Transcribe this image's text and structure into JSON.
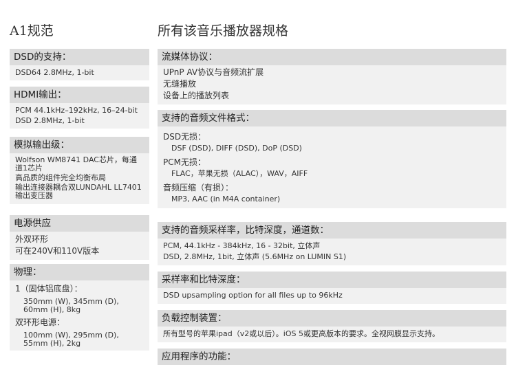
{
  "left_title": "A1规范",
  "right_title": "所有该音乐播放器规格",
  "left_sections": [
    {
      "header": "DSD的支持：",
      "lines": [
        "DSD64 2.8MHz, 1-bit"
      ]
    },
    {
      "header": "HDMI输出：",
      "lines": [
        "PCM 44.1kHz–192kHz, 16–24-bit",
        "DSD 2.8MHz, 1-bit"
      ]
    },
    {
      "header": "模拟输出级：",
      "lines": [
        "Wolfson WM8741 DAC芯片，每通道1芯片",
        "高品质的组件完全均衡布局",
        "输出连接器耦合双LUNDAHL LL7401输出变压器"
      ]
    },
    {
      "header": "电源供应",
      "lines": [
        "外双环形",
        "可在240V和110V版本"
      ]
    },
    {
      "header": "物理：",
      "sub1": "1（固体铝底盘）：",
      "sub1_detail": "350mm (W), 345mm (D), 60mm (H), 8kg",
      "sub2": "双环形电源：",
      "sub2_detail": "100mm (W), 295mm (D), 55mm (H), 2kg"
    }
  ],
  "right_sections": [
    {
      "header": "流媒体协议：",
      "lines": [
        "UPnP AV协议与音频流扩展",
        "无缝播放",
        "设备上的播放列表"
      ]
    },
    {
      "header": "支持的音频文件格式：",
      "groups": [
        {
          "label": "DSD无损：",
          "detail": "DSF (DSD), DIFF (DSD), DoP (DSD)"
        },
        {
          "label": "PCM无损：",
          "detail": "FLAC，苹果无损（ALAC），WAV，AIFF"
        },
        {
          "label": "音频压缩（有损）：",
          "detail": "MP3, AAC (in M4A container)"
        }
      ]
    },
    {
      "header": "支持的音频采样率，比特深度，通道数：",
      "lines": [
        "PCM, 44.1kHz - 384kHz, 16 - 32bit, 立体声",
        "DSD, 2.8MHz, 1bit, 立体声 (5.6MHz on LUMIN S1)"
      ]
    },
    {
      "header": "采样率和比特深度：",
      "lines": [
        "DSD upsampling option for all files up to 96kHz"
      ]
    },
    {
      "header": "负载控制装置：",
      "lines": [
        "所有型号的苹果ipad（v2或以后）。iOS 5或更高版本的要求。全视网膜显示支持。"
      ]
    },
    {
      "header": "应用程序的功能："
    }
  ]
}
